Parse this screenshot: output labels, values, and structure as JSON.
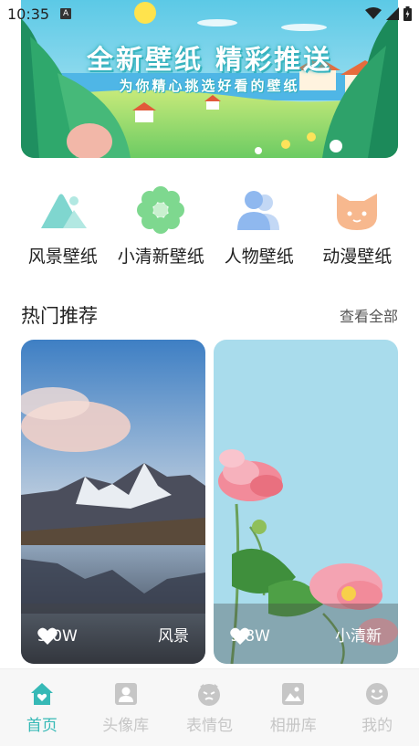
{
  "status_bar": {
    "time": "10:35",
    "badge": "A"
  },
  "banner": {
    "title": "全新壁纸 精彩推送",
    "subtitle": "为你精心挑选好看的壁纸"
  },
  "categories": [
    {
      "label": "风景壁纸",
      "icon": "mountain-icon",
      "color": "#7fd6cf"
    },
    {
      "label": "小清新壁纸",
      "icon": "flower-icon",
      "color": "#7ed88f"
    },
    {
      "label": "人物壁纸",
      "icon": "people-icon",
      "color": "#8fb8ef"
    },
    {
      "label": "动漫壁纸",
      "icon": "cat-icon",
      "color": "#f7b88e"
    }
  ],
  "section": {
    "title": "热门推荐",
    "more": "查看全部"
  },
  "cards": [
    {
      "likes": "5.0W",
      "tag": "风景"
    },
    {
      "likes": "9.8W",
      "tag": "小清新"
    }
  ],
  "tabs": [
    {
      "label": "首页",
      "icon": "home-icon",
      "active": true
    },
    {
      "label": "头像库",
      "icon": "avatar-icon",
      "active": false
    },
    {
      "label": "表情包",
      "icon": "emoji-icon",
      "active": false
    },
    {
      "label": "相册库",
      "icon": "album-icon",
      "active": false
    },
    {
      "label": "我的",
      "icon": "smile-icon",
      "active": false
    }
  ],
  "colors": {
    "accent": "#36b9b6",
    "inactive_tab": "#c6c6c6"
  }
}
